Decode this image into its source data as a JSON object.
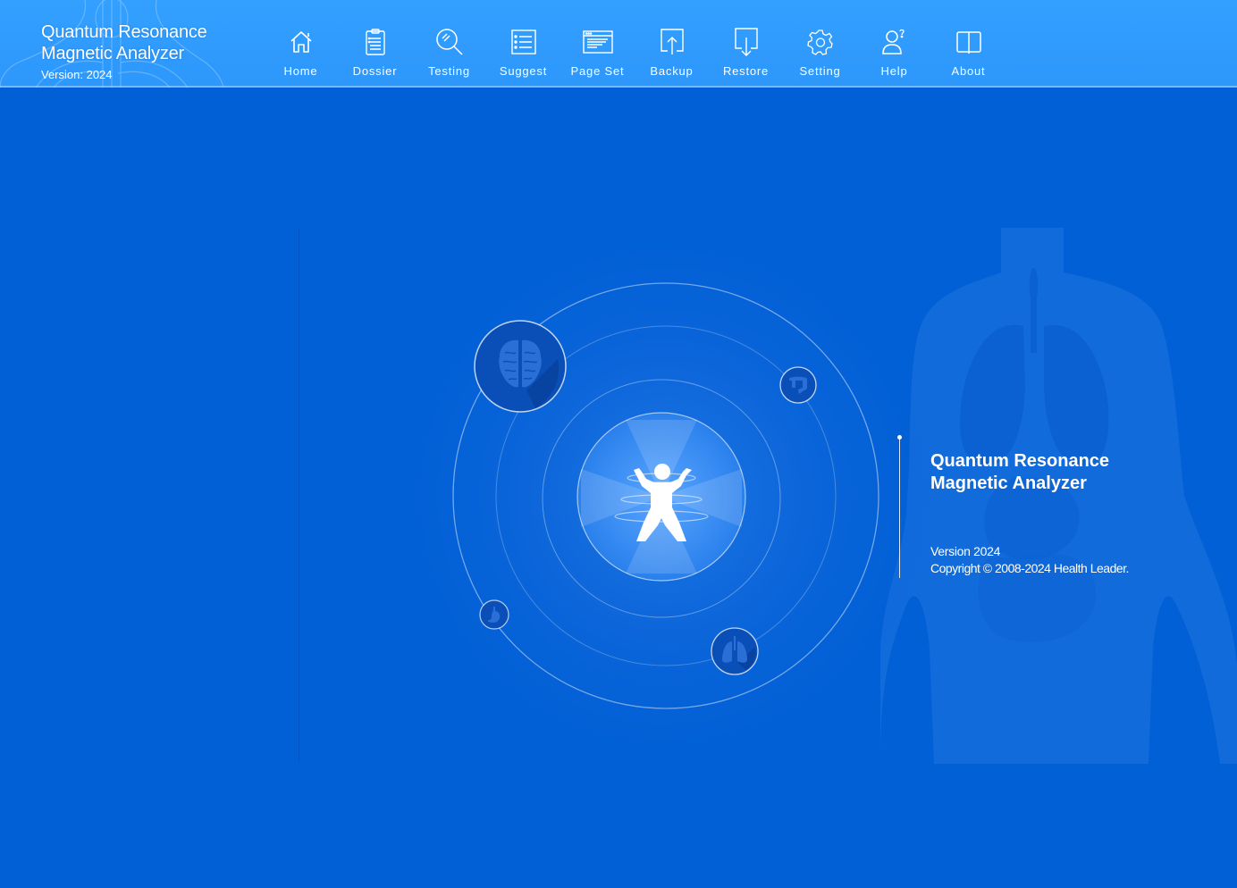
{
  "app": {
    "title_line1": "Quantum Resonance",
    "title_line2": "Magnetic Analyzer",
    "version_label": "Version: 2024"
  },
  "nav": {
    "items": [
      {
        "label": "Home",
        "icon": "home-icon"
      },
      {
        "label": "Dossier",
        "icon": "clipboard-icon"
      },
      {
        "label": "Testing",
        "icon": "magnifier-icon"
      },
      {
        "label": "Suggest",
        "icon": "list-icon"
      },
      {
        "label": "Page Set",
        "icon": "window-icon"
      },
      {
        "label": "Backup",
        "icon": "upload-icon"
      },
      {
        "label": "Restore",
        "icon": "download-icon"
      },
      {
        "label": "Setting",
        "icon": "gear-icon"
      },
      {
        "label": "Help",
        "icon": "user-help-icon"
      },
      {
        "label": "About",
        "icon": "book-icon"
      }
    ]
  },
  "hero": {
    "organs": [
      "brain",
      "intestine",
      "stomach",
      "lungs"
    ],
    "center": "body-scan"
  },
  "info": {
    "title_line1": "Quantum Resonance",
    "title_line2": "Magnetic Analyzer",
    "version": "Version 2024",
    "copyright": "Copyright © 2008-2024 Health Leader."
  },
  "colors": {
    "header": "#2d97fb",
    "background": "#0260d6",
    "accent": "#ffffff"
  }
}
